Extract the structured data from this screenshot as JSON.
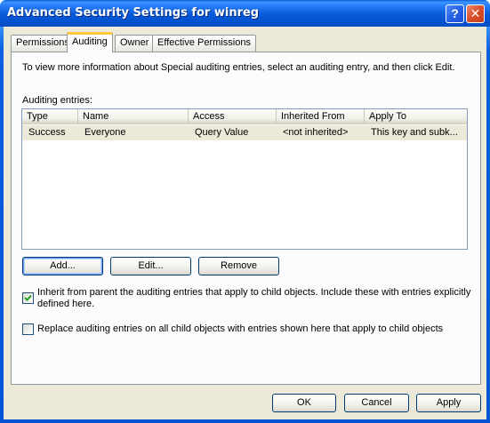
{
  "window": {
    "title": "Advanced Security Settings for winreg",
    "help_glyph": "?",
    "close_glyph": "✕"
  },
  "tabs": [
    {
      "label": "Permissions",
      "active": false
    },
    {
      "label": "Auditing",
      "active": true
    },
    {
      "label": "Owner",
      "active": false
    },
    {
      "label": "Effective Permissions",
      "active": false
    }
  ],
  "panel": {
    "info_text": "To view more information about Special auditing entries, select an auditing entry, and then click Edit.",
    "entries_label": "Auditing entries:",
    "columns": [
      "Type",
      "Name",
      "Access",
      "Inherited From",
      "Apply To"
    ],
    "rows": [
      [
        "Success",
        "Everyone",
        "Query Value",
        "<not inherited>",
        "This key and subk..."
      ]
    ],
    "buttons": {
      "add": "Add...",
      "edit": "Edit...",
      "remove": "Remove"
    },
    "inherit_checkbox": {
      "checked": true,
      "line1": "Inherit from parent the auditing entries that apply to child objects. Include these with entries explicitly",
      "line2": "defined here."
    },
    "replace_checkbox": {
      "checked": false,
      "label": "Replace auditing entries on all child objects with entries shown here that apply to child objects"
    }
  },
  "footer": {
    "ok": "OK",
    "cancel": "Cancel",
    "apply": "Apply"
  }
}
